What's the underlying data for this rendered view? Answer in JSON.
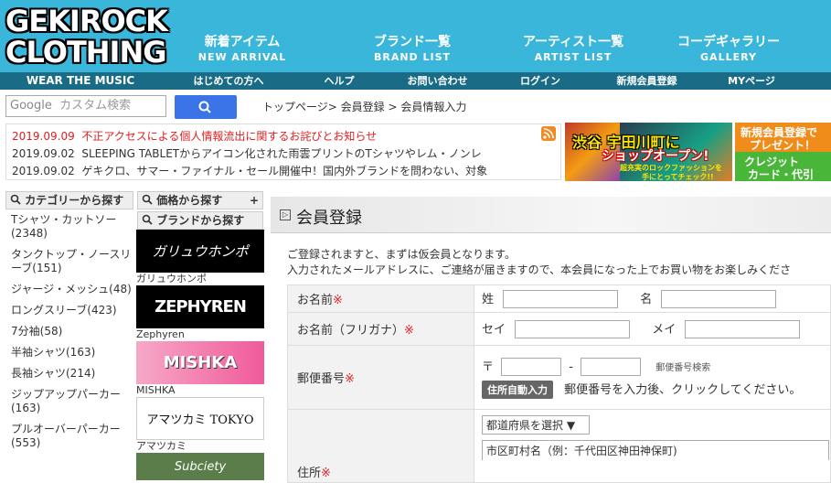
{
  "brand": {
    "logo_line1": "GEKIROCK",
    "logo_line2": "CLOTHING",
    "tagline": "WEAR THE MUSIC"
  },
  "nav": [
    {
      "jp": "新着アイテム",
      "en": "NEW ARRIVAL"
    },
    {
      "jp": "ブランド一覧",
      "en": "BRAND LIST"
    },
    {
      "jp": "アーティスト一覧",
      "en": "ARTIST LIST"
    },
    {
      "jp": "コーデギャラリー",
      "en": "GALLERY"
    }
  ],
  "subnav": [
    "はじめての方へ",
    "ヘルプ",
    "お問い合わせ",
    "ログイン",
    "新規会員登録",
    "MYページ"
  ],
  "search": {
    "brand": "Google",
    "placeholder": "カスタム検索"
  },
  "breadcrumb": "トップページ> 会員登録 > 会員情報入力",
  "news": [
    {
      "date": "2019.09.09",
      "text": "不正アクセスによる個人情報流出に関するお詫びとお知らせ",
      "color": "#e02020"
    },
    {
      "date": "2019.09.02",
      "text": "SLEEPING TABLETからアイコン化された雨雲プリントのTシャツやレム・ノンレ",
      "color": "#333333"
    },
    {
      "date": "2019.09.02",
      "text": "ゲキクロ、サマー・ファイナル・セール開催中！国内外ブランドを問わない、対象",
      "color": "#333333"
    }
  ],
  "banner1": {
    "l1": "渋谷 宇田川町に",
    "l2": "ショップオープン!",
    "l3": "超充実のロックファッションを",
    "l4": "手にとってチェック!!"
  },
  "banner2": {
    "l1": "新規会員登録で",
    "l2": "プレゼント！",
    "l3": "クレジット",
    "l4": "カード・代引"
  },
  "sidebar": {
    "category_title": "カテゴリーから探す",
    "price_title": "価格から探す",
    "brand_title": "ブランドから探す",
    "categories": [
      "Tシャツ・カットソー(2348)",
      "タンクトップ・ノースリーブ(151)",
      "ジャージ・メッシュ(48)",
      "ロングスリーブ(423)",
      "7分袖(58)",
      "半袖シャツ(163)",
      "長袖シャツ(214)",
      "ジップアップパーカー(163)",
      "プルオーバーパーカー(553)"
    ],
    "brands": [
      {
        "logo": "ガリュウホンポ",
        "name": "ガリュウホンポ"
      },
      {
        "logo": "ZEPHYREN",
        "name": "Zephyren"
      },
      {
        "logo": "MISHKA",
        "name": "MISHKA"
      },
      {
        "logo": "アマツカミ TOKYO",
        "name": "アマツカミ"
      },
      {
        "logo": "Subciety",
        "name": ""
      }
    ]
  },
  "main": {
    "title": "会員登録",
    "intro1": "ご登録されますと、まずは仮会員となります。",
    "intro2": "入力されたメールアドレスに、ご連絡が届きますので、本会員になった上でお買い物をお楽しみくださ",
    "required_mark": "※",
    "name_label": "お名前",
    "last_name": "姓",
    "first_name": "名",
    "kana_label": "お名前（フリガナ）",
    "kana_last": "セイ",
    "kana_first": "メイ",
    "zip_label": "郵便番号",
    "zip_symbol": "〒",
    "zip_dash": "-",
    "zip_search": "郵便番号検索",
    "auto_button": "住所自動入力",
    "auto_hint": "郵便番号を入力後、クリックしてください。",
    "address_label": "住所",
    "pref_select": "都道府県を選択",
    "city_hint": "市区町村名（例：千代田区神田神保町)"
  }
}
